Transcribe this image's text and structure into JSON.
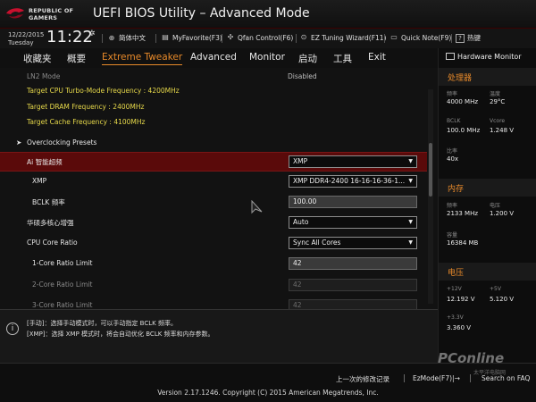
{
  "header": {
    "brand_line1": "REPUBLIC OF",
    "brand_line2": "GAMERS",
    "title": "UEFI BIOS Utility – Advanced Mode"
  },
  "toolbar": {
    "date": "12/22/2015",
    "day": "Tuesday",
    "time": "11:22",
    "items": [
      {
        "icon": "globe-icon",
        "label": "简体中文"
      },
      {
        "icon": "star-doc-icon",
        "label": "MyFavorite(F3)"
      },
      {
        "icon": "fan-icon",
        "label": "Qfan Control(F6)"
      },
      {
        "icon": "wand-icon",
        "label": "EZ Tuning Wizard(F11)"
      },
      {
        "icon": "note-icon",
        "label": "Quick Note(F9)"
      },
      {
        "icon": "help-icon",
        "label": "热键"
      }
    ]
  },
  "nav": {
    "tabs": [
      "收藏夹",
      "概要",
      "Extreme Tweaker",
      "Advanced",
      "Monitor",
      "启动",
      "工具",
      "Exit"
    ],
    "active": "Extreme Tweaker"
  },
  "main": {
    "ln2_label": "LN2 Mode",
    "ln2_value": "Disabled",
    "targets": [
      "Target CPU Turbo-Mode Frequency : 4200MHz",
      "Target DRAM Frequency : 2400MHz",
      "Target Cache Frequency : 4100MHz"
    ],
    "presets_label": "Overclocking Presets",
    "settings": [
      {
        "label": "Ai 智能超频",
        "value": "XMP"
      },
      {
        "label": "XMP",
        "value": "XMP DDR4-2400 16-16-16-36-1..."
      },
      {
        "label": "BCLK 频率",
        "value": "100.00"
      },
      {
        "label": "华硕多核心增强",
        "value": "Auto"
      },
      {
        "label": "CPU Core Ratio",
        "value": "Sync All Cores"
      },
      {
        "label": "1-Core Ratio Limit",
        "value": "42"
      },
      {
        "label": "2-Core Ratio Limit",
        "value": "42"
      },
      {
        "label": "3-Core Ratio Limit",
        "value": "42"
      }
    ]
  },
  "help": {
    "line1": "[手动]：选择手动模式时，可以手动指定 BCLK 频率。",
    "line2": "[XMP]：选择 XMP 模式时，将会自动优化 BCLK 频率和内存参数。"
  },
  "hw": {
    "title": "Hardware Monitor",
    "cpu": {
      "section": "处理器",
      "freq_label": "频率",
      "freq_value": "4000 MHz",
      "temp_label": "温度",
      "temp_value": "29°C",
      "bclk_label": "BCLK",
      "bclk_value": "100.0 MHz",
      "vcore_label": "Vcore",
      "vcore_value": "1.248 V",
      "ratio_label": "比率",
      "ratio_value": "40x"
    },
    "mem": {
      "section": "内存",
      "freq_label": "频率",
      "freq_value": "2133 MHz",
      "volt_label": "电压",
      "volt_value": "1.200 V",
      "cap_label": "容量",
      "cap_value": "16384 MB"
    },
    "volt": {
      "section": "电压",
      "v12_label": "+12V",
      "v12_value": "12.192 V",
      "v5_label": "+5V",
      "v5_value": "5.120 V",
      "v33_label": "+3.3V",
      "v33_value": "3.360 V"
    }
  },
  "bottom": {
    "last_modified": "上一次的修改记录",
    "ezmode": "EzMode(F7)|→",
    "search": "Search on FAQ",
    "version": "Version 2.17.1246. Copyright (C) 2015 American Megatrends, Inc."
  },
  "watermark": {
    "text": "PConline",
    "sub": "太平洋电脑网"
  }
}
